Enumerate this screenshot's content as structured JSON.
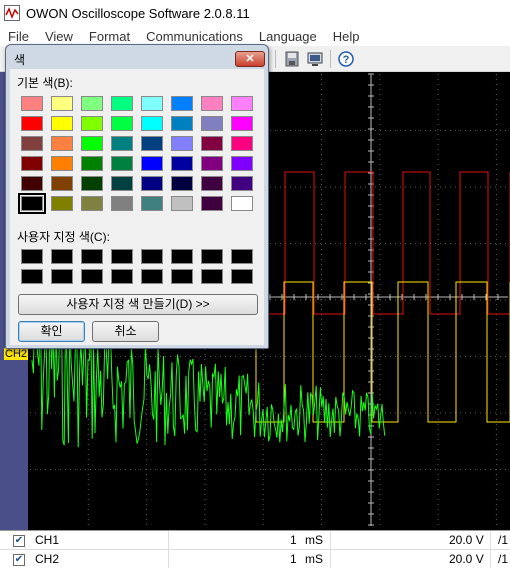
{
  "window": {
    "title": "OWON Oscilloscope Software 2.0.8.11"
  },
  "menu": [
    "File",
    "View",
    "Format",
    "Communications",
    "Language",
    "Help"
  ],
  "toolbar": {
    "icons": [
      "save-icon",
      "monitor-icon",
      "help-icon"
    ]
  },
  "scope": {
    "ch2_label": "CH2",
    "colors": {
      "background": "#000000",
      "grid": "#5a5a5a",
      "ch1_yellow": "#ffe600",
      "ch2_green": "#19ff19",
      "ref_red": "#e01010",
      "left_strip": "#4a4f8a"
    }
  },
  "color_dialog": {
    "title": "색",
    "basic_colors_label": "기본 색(B):",
    "custom_colors_label": "사용자 지정 색(C):",
    "define_custom_button": "사용자 지정 색 만들기(D) >>",
    "ok_button": "확인",
    "cancel_button": "취소",
    "close_glyph": "✕",
    "basic_colors": [
      [
        "#ff8080",
        "#ffff80",
        "#80ff80",
        "#00ff80",
        "#80ffff",
        "#0080ff",
        "#ff80c0",
        "#ff80ff"
      ],
      [
        "#ff0000",
        "#ffff00",
        "#80ff00",
        "#00ff40",
        "#00ffff",
        "#0080c0",
        "#8080c0",
        "#ff00ff"
      ],
      [
        "#804040",
        "#ff8040",
        "#00ff00",
        "#008080",
        "#004080",
        "#8080ff",
        "#800040",
        "#ff0080"
      ],
      [
        "#800000",
        "#ff8000",
        "#008000",
        "#008040",
        "#0000ff",
        "#0000a0",
        "#800080",
        "#8000ff"
      ],
      [
        "#400000",
        "#804000",
        "#004000",
        "#004040",
        "#000080",
        "#000040",
        "#400040",
        "#400080"
      ],
      [
        "#000000",
        "#808000",
        "#808040",
        "#808080",
        "#408080",
        "#c0c0c0",
        "#400040",
        "#ffffff"
      ]
    ],
    "selected_color": "#000000",
    "custom_colors": [
      "#000000",
      "#000000",
      "#000000",
      "#000000",
      "#000000",
      "#000000",
      "#000000",
      "#000000",
      "#000000",
      "#000000",
      "#000000",
      "#000000",
      "#000000",
      "#000000",
      "#000000",
      "#000000"
    ]
  },
  "channels": [
    {
      "name": "CH1",
      "checked": true,
      "time_div": "1",
      "time_unit": "mS",
      "volt_div": "20.0 V",
      "extra": "/1"
    },
    {
      "name": "CH2",
      "checked": true,
      "time_div": "1",
      "time_unit": "mS",
      "volt_div": "20.0 V",
      "extra": "/1"
    }
  ]
}
